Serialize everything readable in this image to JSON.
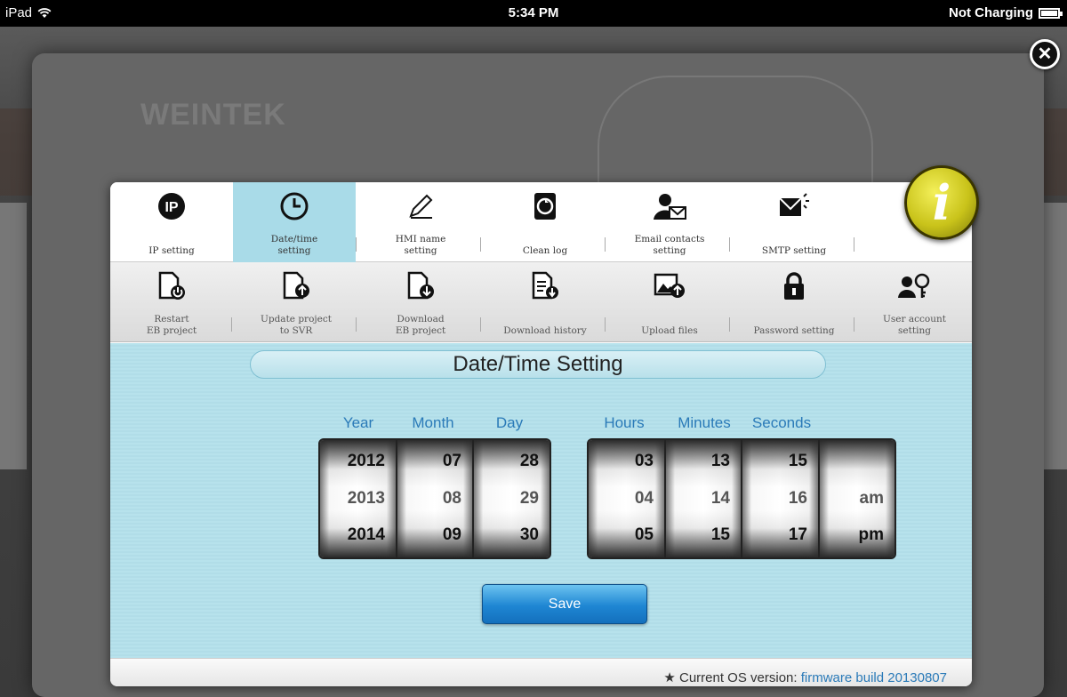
{
  "status_bar": {
    "device": "iPad",
    "time": "5:34 PM",
    "battery": "Not Charging"
  },
  "brand": "WEINTEK",
  "menu_row1": [
    {
      "id": "ip",
      "label": "IP setting",
      "icon": "ip-icon"
    },
    {
      "id": "datetime",
      "label": "Date/time\nsetting",
      "icon": "clock-icon",
      "active": true
    },
    {
      "id": "hmi",
      "label": "HMI name\nsetting",
      "icon": "pencil-icon"
    },
    {
      "id": "cleanlog",
      "label": "Clean log",
      "icon": "recycle-bin-icon"
    },
    {
      "id": "email",
      "label": "Email contacts\nsetting",
      "icon": "contact-email-icon"
    },
    {
      "id": "smtp",
      "label": "SMTP setting",
      "icon": "mail-send-icon"
    }
  ],
  "menu_row2": [
    {
      "id": "restart",
      "label": "Restart\nEB project",
      "icon": "document-power-icon"
    },
    {
      "id": "update",
      "label": "Update project\nto SVR",
      "icon": "document-upload-icon"
    },
    {
      "id": "download",
      "label": "Download\nEB project",
      "icon": "document-download-icon"
    },
    {
      "id": "history",
      "label": "Download history",
      "icon": "document-history-icon"
    },
    {
      "id": "upload",
      "label": "Upload files",
      "icon": "image-upload-icon"
    },
    {
      "id": "password",
      "label": "Password setting",
      "icon": "lock-icon"
    },
    {
      "id": "user",
      "label": "User account\nsetting",
      "icon": "user-key-icon"
    }
  ],
  "title": "Date/Time Setting",
  "columns": {
    "year": "Year",
    "month": "Month",
    "day": "Day",
    "hours": "Hours",
    "minutes": "Minutes",
    "seconds": "Seconds"
  },
  "date_picker": {
    "year": [
      "2012",
      "2013",
      "2014"
    ],
    "month": [
      "07",
      "08",
      "09"
    ],
    "day": [
      "28",
      "29",
      "30"
    ]
  },
  "time_picker": {
    "hours": [
      "03",
      "04",
      "05"
    ],
    "minutes": [
      "13",
      "14",
      "15"
    ],
    "seconds": [
      "15",
      "16",
      "17"
    ],
    "ampm": [
      "",
      "am",
      "pm"
    ]
  },
  "save_label": "Save",
  "footer": {
    "prefix": "Current OS version:",
    "version": "firmware build 20130807"
  },
  "colors": {
    "accent": "#2a7ab8",
    "content_bg": "#b7e2ec",
    "selection": "#a9a9e0",
    "save_button": "#1e86d3"
  }
}
